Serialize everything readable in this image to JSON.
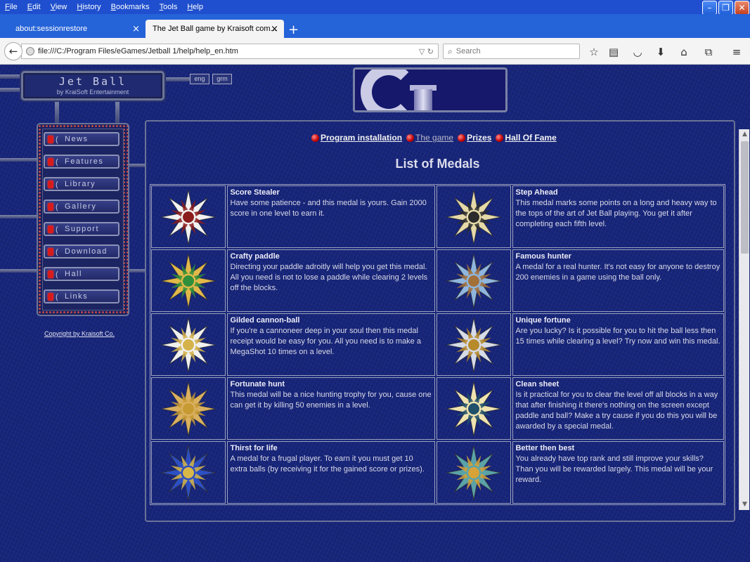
{
  "menu": [
    "File",
    "Edit",
    "View",
    "History",
    "Bookmarks",
    "Tools",
    "Help"
  ],
  "tabs": [
    {
      "label": "about:sessionrestore",
      "close": "×"
    },
    {
      "label": "The Jet Ball game by Kraisoft com...",
      "close": "×"
    }
  ],
  "new_tab": "+",
  "url": "file:///C:/Program Files/eGames/Jetball 1/help/help_en.htm",
  "url_ctrl": "▽ ↻",
  "search": {
    "placeholder": "Search"
  },
  "logo": {
    "title": "Jet Ball",
    "subtitle": "by KraiSoft Entertainment"
  },
  "lang": [
    "eng",
    "grm"
  ],
  "nav": [
    "News",
    "Features",
    "Library",
    "Gallery",
    "Support",
    "Download",
    "Hall",
    "Links"
  ],
  "copyright": "Copyright by Kraisoft Co.",
  "top_links": [
    "Program installation",
    "The game",
    "Prizes",
    "Hall Of Fame"
  ],
  "list_title": "List of Medals",
  "medals": [
    {
      "title": "Score Stealer",
      "text": "Have some patience - and this medal is yours. Gain 2000 score in one level to earn it.",
      "colors": [
        "#f2f2f2",
        "#8b1c1c"
      ]
    },
    {
      "title": "Step Ahead",
      "text": "This medal marks some points on a long and heavy way to the tops of the art of Jet Ball playing. You get it after completing each fifth level.",
      "colors": [
        "#e5d9a8",
        "#2b2b2b"
      ]
    },
    {
      "title": "Crafty paddle",
      "text": "Directing your paddle adroitly will help you get this medal. All you need is not to lose a paddle while clearing 2 levels off the blocks.",
      "colors": [
        "#e1b84a",
        "#2f8f3a"
      ]
    },
    {
      "title": "Famous hunter",
      "text": "A medal for a real hunter. It's not easy for anyone to destroy 200 enemies in a game using the ball only.",
      "colors": [
        "#8fb6de",
        "#a3703a"
      ]
    },
    {
      "title": "Gilded cannon-ball",
      "text": "If you're a cannoneer deep in your soul then this medal receipt would be easy for you. All you need is to make a MegaShot 10 times on a level.",
      "colors": [
        "#f0f0f0",
        "#d6b34a"
      ]
    },
    {
      "title": "Unique fortune",
      "text": "Are you lucky? Is it possible for you to hit the ball less then 15 times while clearing a level? Try now and win this medal.",
      "colors": [
        "#d6dbe8",
        "#b78a2a"
      ]
    },
    {
      "title": "Fortunate hunt",
      "text": "This medal will be a nice hunting trophy for you, cause one can get it by killing 50 enemies in a level.",
      "colors": [
        "#d9b060",
        "#c79a32"
      ]
    },
    {
      "title": "Clean sheet",
      "text": "Is it practical for you to clear the level off all blocks in a way that after finishing it there's nothing on the screen except paddle and ball? Make a try cause if you do this you will be awarded by a special medal.",
      "colors": [
        "#efe3b0",
        "#20506a"
      ]
    },
    {
      "title": "Thirst for life",
      "text": "A medal for a frugal player. To earn it you must get 10 extra balls (by receiving it for the gained score or prizes).",
      "colors": [
        "#2c4fc4",
        "#d9b84a"
      ]
    },
    {
      "title": "Better then best",
      "text": "You already have top rank and still improve your skills? Than you will be rewarded largely. This medal will be your reward.",
      "colors": [
        "#5aa3a8",
        "#d7a338"
      ]
    }
  ]
}
